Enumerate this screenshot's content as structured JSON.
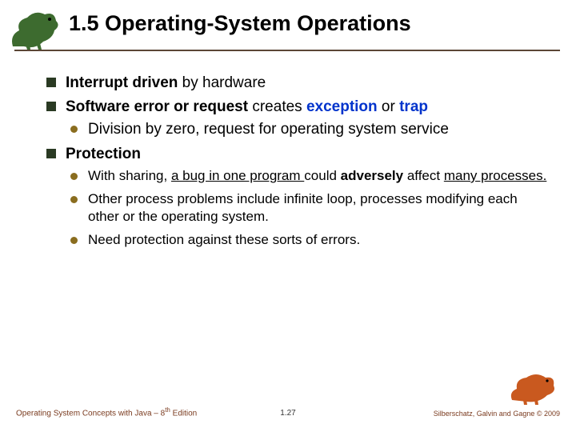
{
  "header": {
    "title": "1.5 Operating-System Operations"
  },
  "bullets": {
    "b1_pre": "Interrupt driven",
    "b1_post": " by hardware",
    "b2_pre": "Software error or request",
    "b2_mid": " creates ",
    "b2_blue1": "exception",
    "b2_conj": " or ",
    "b2_blue2": "trap",
    "b2_sub1": "Division by zero, request for operating system service",
    "b3": "Protection",
    "b3_sub1_a": "With sharing, ",
    "b3_sub1_u1": "a bug in one program ",
    "b3_sub1_b": "could ",
    "b3_sub1_bold": "adversely",
    "b3_sub1_c": " affect ",
    "b3_sub1_u2": "many processes.",
    "b3_sub2": "Other process problems include infinite loop, processes modifying each other or the operating system.",
    "b3_sub3": "Need protection against these sorts of errors."
  },
  "footer": {
    "left_a": "Operating System Concepts with Java – 8",
    "left_sup": "th",
    "left_b": " Edition",
    "center": "1.27",
    "right": "Silberschatz, Galvin and Gagne © 2009"
  },
  "icons": {
    "dino_left": "dinosaur-left-icon",
    "dino_right": "dinosaur-right-icon"
  }
}
